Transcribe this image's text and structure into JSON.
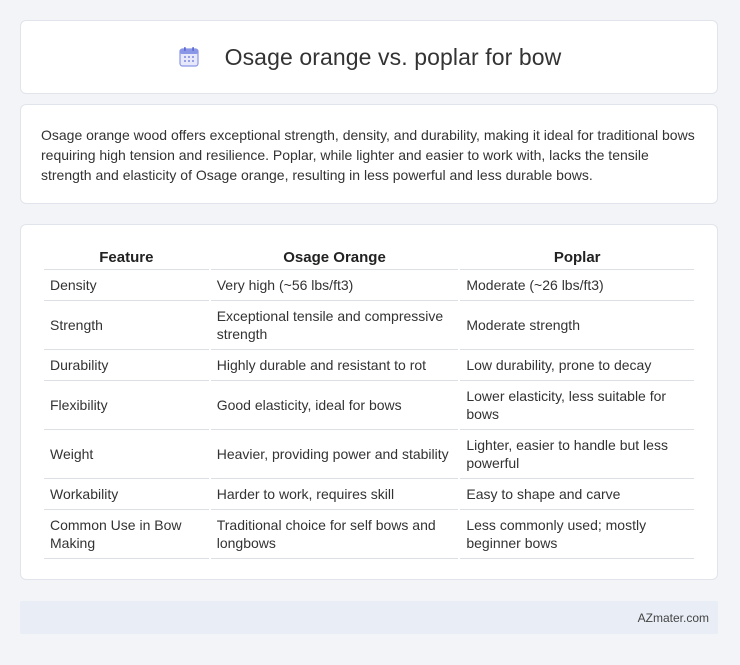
{
  "header": {
    "title": "Osage orange vs. poplar for bow",
    "icon": "calendar-icon"
  },
  "summary": {
    "text": "Osage orange wood offers exceptional strength, density, and durability, making it ideal for traditional bows requiring high tension and resilience. Poplar, while lighter and easier to work with, lacks the tensile strength and elasticity of Osage orange, resulting in less powerful and less durable bows."
  },
  "table": {
    "headers": [
      "Feature",
      "Osage Orange",
      "Poplar"
    ],
    "rows": [
      [
        "Density",
        "Very high (~56 lbs/ft3)",
        "Moderate (~26 lbs/ft3)"
      ],
      [
        "Strength",
        "Exceptional tensile and compressive strength",
        "Moderate strength"
      ],
      [
        "Durability",
        "Highly durable and resistant to rot",
        "Low durability, prone to decay"
      ],
      [
        "Flexibility",
        "Good elasticity, ideal for bows",
        "Lower elasticity, less suitable for bows"
      ],
      [
        "Weight",
        "Heavier, providing power and stability",
        "Lighter, easier to handle but less powerful"
      ],
      [
        "Workability",
        "Harder to work, requires skill",
        "Easy to shape and carve"
      ],
      [
        "Common Use in Bow Making",
        "Traditional choice for self bows and longbows",
        "Less commonly used; mostly beginner bows"
      ]
    ]
  },
  "footer": {
    "brand": "AZmater.com"
  },
  "colors": {
    "background": "#f3f4f8",
    "card": "#ffffff",
    "footer": "#e8edf6",
    "icon_accent": "#6c7bd8"
  }
}
